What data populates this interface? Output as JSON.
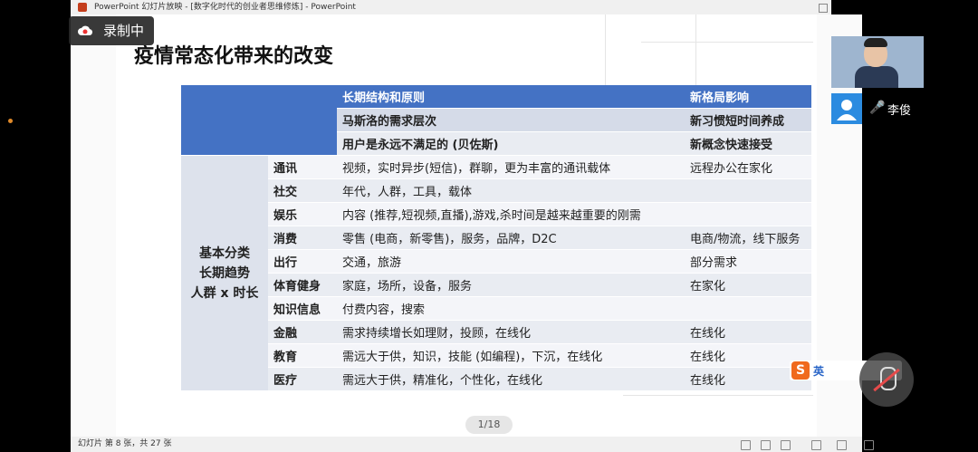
{
  "window": {
    "title": "PowerPoint 幻灯片放映 - [数字化时代的创业者思维修炼] - PowerPoint"
  },
  "recording": {
    "label": "录制中"
  },
  "participant": {
    "name": "李俊"
  },
  "slide": {
    "title": "疫情常态化带来的改变",
    "table": {
      "header": {
        "col2": "长期结构和原则",
        "col3": "新格局影响"
      },
      "subheaders": [
        {
          "col2": "马斯洛的需求层次",
          "col3": "新习惯短时间养成"
        },
        {
          "col2": "用户是永远不满足的 (贝佐斯)",
          "col3": "新概念快速接受"
        }
      ],
      "category": {
        "line1": "基本分类",
        "line2": "长期趋势",
        "line3": "人群 x 时长"
      },
      "rows": [
        {
          "name": "通讯",
          "desc": "视频，实时异步(短信)，群聊，更为丰富的通讯载体",
          "impact": "远程办公在家化"
        },
        {
          "name": "社交",
          "desc": "年代，人群，工具，载体",
          "impact": ""
        },
        {
          "name": "娱乐",
          "desc": "内容 (推荐,短视频,直播),游戏,杀时间是越来越重要的刚需",
          "impact": ""
        },
        {
          "name": "消费",
          "desc": "零售 (电商，新零售)，服务，品牌，D2C",
          "impact": "电商/物流，线下服务"
        },
        {
          "name": "出行",
          "desc": "交通，旅游",
          "impact": "部分需求"
        },
        {
          "name": "体育健身",
          "desc": "家庭，场所，设备，服务",
          "impact": "在家化"
        },
        {
          "name": "知识信息",
          "desc": "付费内容，搜索",
          "impact": ""
        },
        {
          "name": "金融",
          "desc": "需求持续增长如理财，投顾，在线化",
          "impact": "在线化"
        },
        {
          "name": "教育",
          "desc": "需远大于供，知识，技能 (如编程)，下沉，在线化",
          "impact": "在线化"
        },
        {
          "name": "医疗",
          "desc": "需远大于供，精准化，个性化，在线化",
          "impact": "在线化"
        }
      ]
    },
    "page_indicator": "1/18"
  },
  "statusbar": {
    "text": "幻灯片 第 8 张，共 27 张"
  },
  "ime": {
    "lang": "英",
    "logo": "S"
  },
  "colors": {
    "header_blue": "#4472c4",
    "row_light": "#e9ecf2",
    "brand_orange": "#f06a1d"
  }
}
